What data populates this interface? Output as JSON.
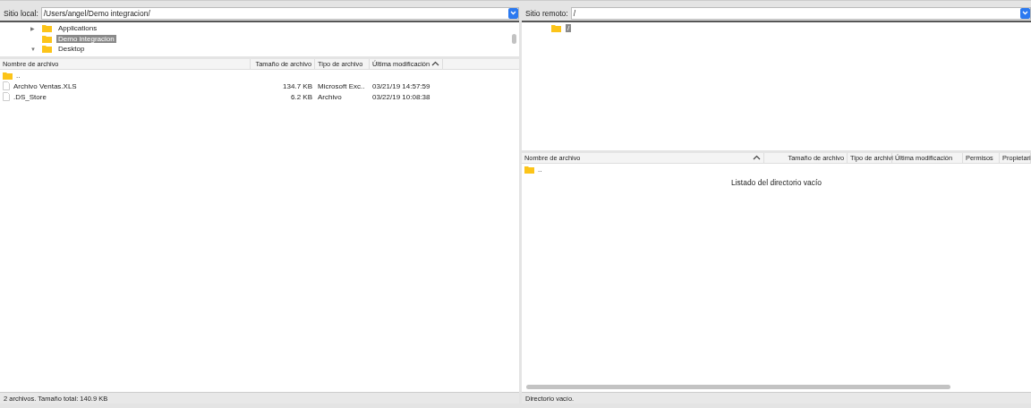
{
  "local": {
    "site_label": "Sitio local:",
    "path": "/Users/angel/Demo integracion/",
    "tree": [
      {
        "toggle": "▶",
        "label": "Applications",
        "selected": false
      },
      {
        "label": "Demo integracion",
        "selected": true
      },
      {
        "toggle": "▼",
        "label": "Desktop",
        "selected": false
      }
    ],
    "columns": [
      {
        "label": "Nombre de archivo",
        "sorted": false
      },
      {
        "label": "Tamaño de archivo",
        "sorted": false
      },
      {
        "label": "Tipo de archivo",
        "sorted": false
      },
      {
        "label": "Última modificación",
        "sorted": true
      }
    ],
    "rows": [
      {
        "kind": "parent",
        "cells": [
          ".."
        ]
      },
      {
        "kind": "file",
        "cells": [
          "Archivo Ventas.XLS",
          "134.7 KB",
          "Microsoft Exc..",
          "03/21/19 14:57:59"
        ]
      },
      {
        "kind": "file",
        "cells": [
          ".DS_Store",
          "6.2 KB",
          "Archivo",
          "03/22/19 10:08:38"
        ]
      }
    ],
    "status": "2 archivos. Tamaño total: 140.9 KB"
  },
  "remote": {
    "site_label": "Sitio remoto:",
    "path": "/",
    "tree": [
      {
        "label": "/",
        "selected": true
      }
    ],
    "columns": [
      {
        "label": "Nombre de archivo",
        "sorted": true
      },
      {
        "label": "Tamaño de archivo",
        "sorted": false
      },
      {
        "label": "Tipo de archivi",
        "sorted": false
      },
      {
        "label": "Última modificación",
        "sorted": false
      },
      {
        "label": "Permisos",
        "sorted": false
      },
      {
        "label": "Propietari",
        "sorted": false
      }
    ],
    "rows": [
      {
        "kind": "parent",
        "cells": [
          ".."
        ]
      }
    ],
    "empty_message": "Listado del directorio vacío",
    "status": "Directorio vacío."
  }
}
